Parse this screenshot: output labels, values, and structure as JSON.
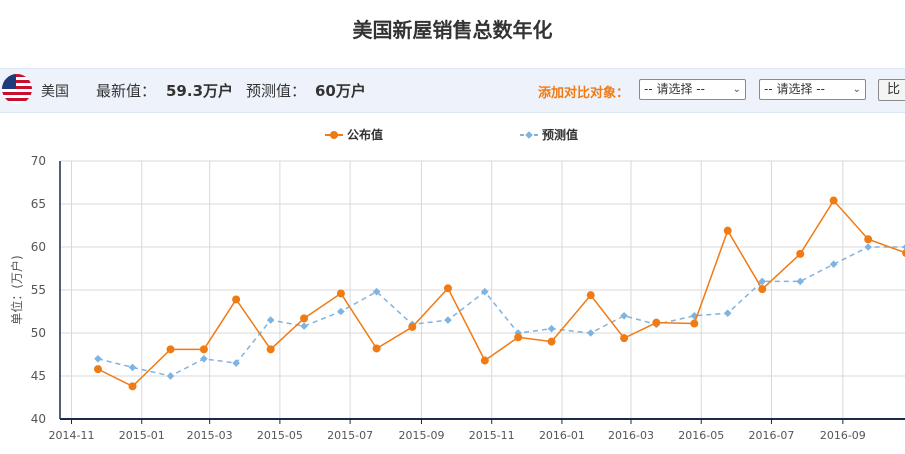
{
  "title": "美国新屋销售总数年化",
  "infobar": {
    "country": "美国",
    "latest_label": "最新值：",
    "latest_value": "59.3万户",
    "forecast_label": "预测值：",
    "forecast_value": "60万户",
    "compare_label": "添加对比对象：",
    "select1": "-- 请选择 --",
    "select2": "-- 请选择 --",
    "compare_button": "比"
  },
  "colors": {
    "published": "#f07a13",
    "forecast": "#7fb3e0"
  },
  "chart_data": {
    "type": "line",
    "ylabel": "单位：(万户)",
    "ylim": [
      40,
      70
    ],
    "yticks": [
      40,
      45,
      50,
      55,
      60,
      65,
      70
    ],
    "xlim": [
      "2014-10-22",
      "2016-10-25"
    ],
    "xticks": [
      "2014-11",
      "2015-01",
      "2015-03",
      "2015-05",
      "2015-07",
      "2015-09",
      "2015-11",
      "2016-01",
      "2016-03",
      "2016-05",
      "2016-07",
      "2016-09"
    ],
    "grid": true,
    "legend_position": "top-center",
    "x": [
      "2014-11-24",
      "2014-12-24",
      "2015-01-26",
      "2015-02-24",
      "2015-03-24",
      "2015-04-23",
      "2015-05-22",
      "2015-06-23",
      "2015-07-24",
      "2015-08-24",
      "2015-09-24",
      "2015-10-26",
      "2015-11-24",
      "2015-12-23",
      "2016-01-26",
      "2016-02-24",
      "2016-03-23",
      "2016-04-25",
      "2016-05-24",
      "2016-06-23",
      "2016-07-26",
      "2016-08-24",
      "2016-09-23",
      "2016-10-26"
    ],
    "series": [
      {
        "name": "公布值",
        "color": "#f07a13",
        "marker": "circle",
        "dashed": false,
        "values": [
          45.8,
          43.8,
          48.1,
          48.1,
          53.9,
          48.1,
          51.7,
          54.6,
          48.2,
          50.7,
          55.2,
          46.8,
          49.5,
          49.0,
          54.4,
          49.4,
          51.2,
          51.1,
          61.9,
          55.1,
          59.2,
          65.4,
          60.9,
          59.3
        ]
      },
      {
        "name": "预测值",
        "color": "#7fb3e0",
        "marker": "diamond",
        "dashed": true,
        "values": [
          47.0,
          46.0,
          45.0,
          47.0,
          46.5,
          51.5,
          50.8,
          52.5,
          54.8,
          51.0,
          51.5,
          54.8,
          50.0,
          50.5,
          50.0,
          52.0,
          51.0,
          52.0,
          52.3,
          56.0,
          56.0,
          58.0,
          60.0,
          60.0
        ]
      }
    ]
  }
}
